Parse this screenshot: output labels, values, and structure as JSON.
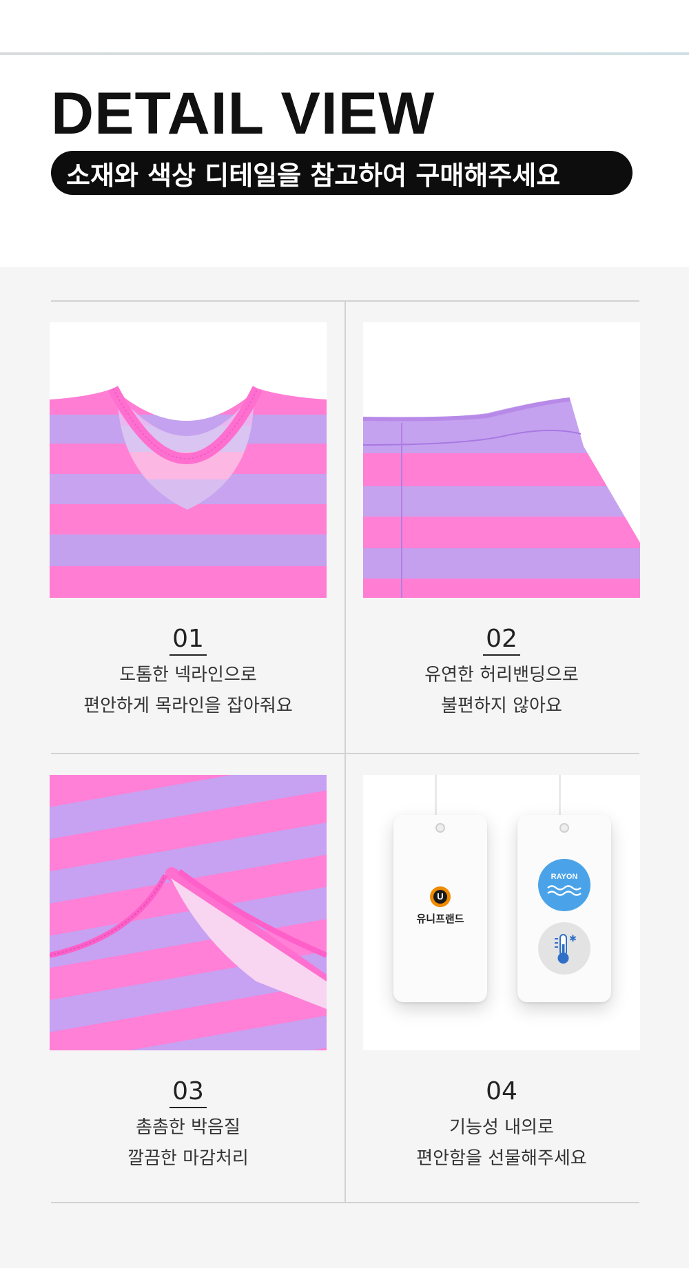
{
  "header": {
    "title": "DETAIL VIEW",
    "subtitle": "소재와 색상 디테일을 참고하여 구매해주세요"
  },
  "details": [
    {
      "number": "01",
      "line1": "도톰한 넥라인으로",
      "line2": "편안하게 목라인을 잡아줘요"
    },
    {
      "number": "02",
      "line1": "유연한 허리밴딩으로",
      "line2": "불편하지 않아요"
    },
    {
      "number": "03",
      "line1": "촘촘한 박음질",
      "line2": "깔끔한 마감처리"
    },
    {
      "number": "04",
      "line1": "기능성 내의로",
      "line2": "편안함을 선물해주세요"
    }
  ],
  "tags": {
    "brand_name": "유니프랜드",
    "brand_logo_letter": "U",
    "rayon_label": "RAYON"
  },
  "colors": {
    "stripe_pink": "#ff7ed4",
    "stripe_lavender": "#c5a0f0",
    "rayon_badge": "#4aa3e8",
    "logo_orange": "#f08a00"
  }
}
